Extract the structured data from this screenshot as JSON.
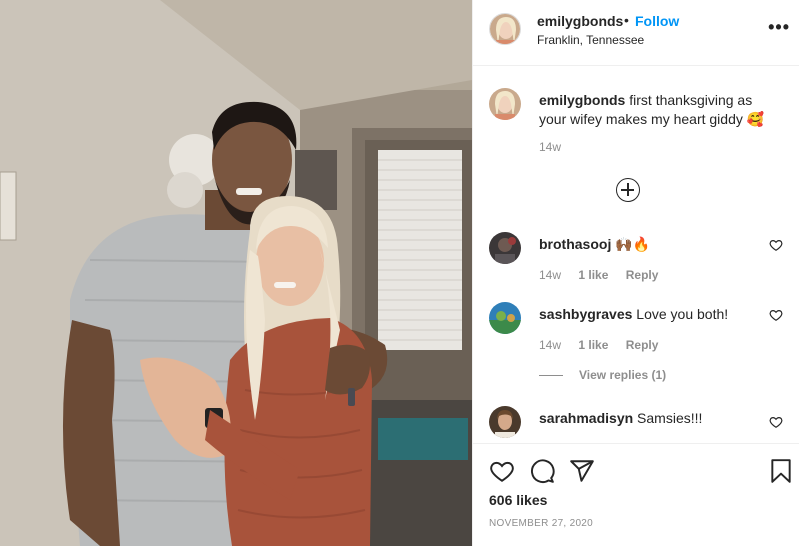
{
  "post": {
    "username": "emilygbonds",
    "separator": "•",
    "follow_label": "Follow",
    "location": "Franklin, Tennessee",
    "more_label": "•••"
  },
  "caption": {
    "username": "emilygbonds",
    "text": " first thanksgiving as your wifey makes my heart giddy 🥰",
    "time": "14w"
  },
  "comments": [
    {
      "username": "brothasooj",
      "text": " 🙌🏾🔥",
      "time": "14w",
      "likes": "1 like",
      "reply": "Reply"
    },
    {
      "username": "sashbygraves",
      "text": " Love you both!",
      "time": "14w",
      "likes": "1 like",
      "reply": "Reply"
    },
    {
      "username": "sarahmadisyn",
      "text": " Samsies!!!"
    }
  ],
  "view_replies": "View replies (1)",
  "likes_count": "606 likes",
  "date": "NOVEMBER 27, 2020",
  "icons": {
    "like": "heart-icon",
    "comment": "comment-icon",
    "share": "paper-plane-icon",
    "save": "bookmark-icon",
    "load_more": "plus-circle-icon",
    "more": "ellipsis-icon"
  },
  "colors": {
    "accent": "#0095f6",
    "text": "#262626",
    "muted": "#8e8e8e",
    "divider": "#efefef"
  }
}
